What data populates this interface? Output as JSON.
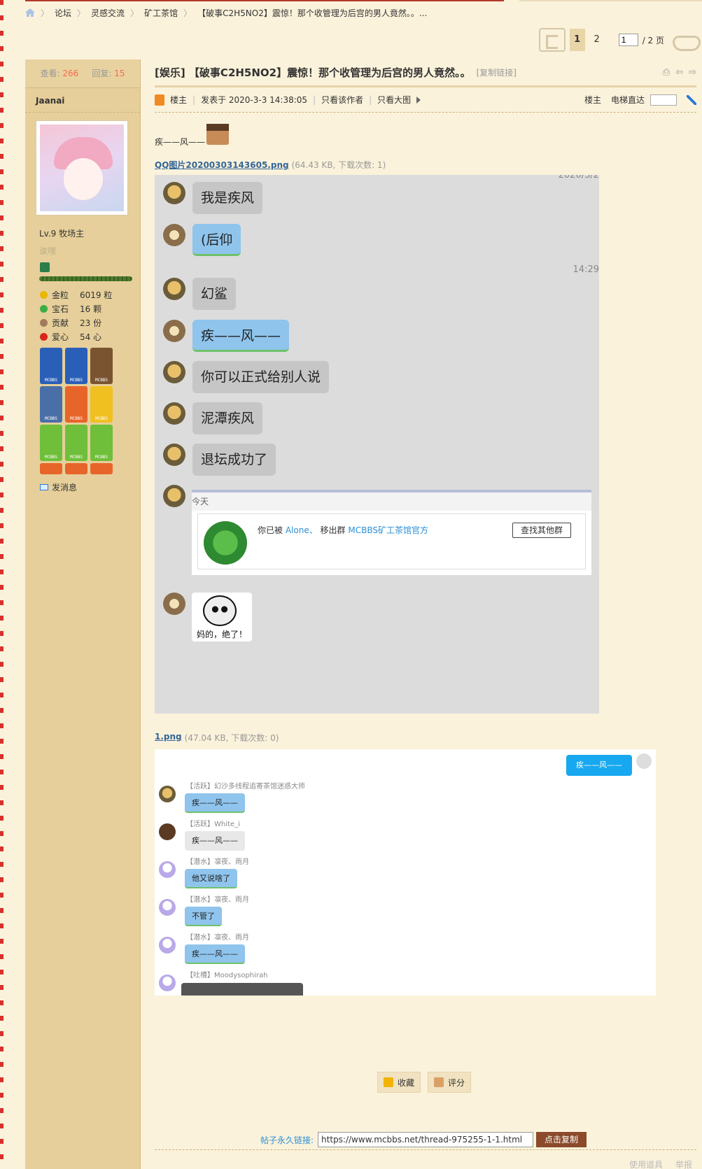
{
  "breadcrumb": [
    "论坛",
    "灵感交流",
    "矿工茶馆",
    "【破事C2H5NO2】震惊！那个收管理为后宫的男人竟然。。..."
  ],
  "pager": {
    "pages": [
      "1",
      "2"
    ],
    "current": "1",
    "input_value": "1",
    "total": "/ 2 页"
  },
  "sidebar": {
    "views_label": "查看:",
    "views": "266",
    "replies_label": "回复:",
    "replies": "15",
    "username": "Jaanai",
    "level": "Lv.9 牧场主",
    "usertitle": "诶嘿",
    "stats": [
      {
        "k": "金粒",
        "v": "6019 粒",
        "color": "#e9b600"
      },
      {
        "k": "宝石",
        "v": "16 颗",
        "color": "#3cae44"
      },
      {
        "k": "贡献",
        "v": "23 份",
        "color": "#a07a5a"
      },
      {
        "k": "爱心",
        "v": "54 心",
        "color": "#d8261b"
      }
    ],
    "medals": [
      {
        "label": "MCBBS",
        "color": "#2a5fb8"
      },
      {
        "label": "MCBBS",
        "color": "#2a5fb8"
      },
      {
        "label": "MCBBS",
        "color": "#7a5430"
      },
      {
        "label": "MCBBS",
        "color": "#4a6fa8"
      },
      {
        "label": "MCBBS",
        "color": "#e8652a"
      },
      {
        "label": "MCBBS",
        "color": "#f0c020"
      },
      {
        "label": "MCBBS",
        "color": "#6fbf3a"
      },
      {
        "label": "MCBBS",
        "color": "#6fbf3a"
      },
      {
        "label": "MCBBS",
        "color": "#6fbf3a"
      }
    ],
    "send_message": "发消息"
  },
  "post": {
    "title": "[娱乐] 【破事C2H5NO2】震惊！那个收管理为后宫的男人竟然。。",
    "copy_link": "[复制链接]",
    "louzhu": "楼主",
    "posted": "发表于 2020-3-3 14:38:05",
    "only_author": "只看该作者",
    "big_image": "只看大图",
    "floor": "楼主",
    "elevator": "电梯直达",
    "body_text": "疾——风——"
  },
  "attachment1": {
    "name": "QQ图片20200303143605.png",
    "info": "(64.43 KB, 下载次数: 1)"
  },
  "chat1": {
    "date_stamp": "2020/3/2",
    "time_stamp": "14:29",
    "messages": [
      "我是疾风",
      "(后仰",
      "幻鲨",
      "疾——风——",
      "你可以正式给别人说",
      "泥潭疾风",
      "退坛成功了"
    ],
    "card_day": "今天",
    "card_text_prefix": "你已被",
    "card_user": "Alone、",
    "card_text_mid": "移出群",
    "card_group": "MCBBS矿工茶馆官方",
    "card_button": "查找其他群",
    "sticker_caption": "妈的，绝了！"
  },
  "attachment2": {
    "name": "1.png",
    "info": "(47.04 KB, 下载次数: 0)"
  },
  "chat2": {
    "self_msg": "疾——风——",
    "rows": [
      {
        "name": "【活跃】幻沙多线程追寄茶馆迷惑大师",
        "msg": "疾——风——"
      },
      {
        "name": "【活跃】White_i",
        "msg": "疾——风——"
      },
      {
        "name": "【潜水】凛夜、雨月",
        "msg": "他又说啥了"
      },
      {
        "name": "【潜水】凛夜、雨月",
        "msg": "不管了"
      },
      {
        "name": "【潜水】凛夜、雨月",
        "msg": "疾——风——"
      },
      {
        "name": "【吐槽】Moodysophirah",
        "msg": ""
      }
    ]
  },
  "actions": {
    "favorite": "收藏",
    "rate": "评分"
  },
  "permalink": {
    "label": "帖子永久链接:",
    "url": "https://www.mcbbs.net/thread-975255-1-1.html",
    "button": "点击复制"
  },
  "footer": {
    "tools": "使用道具",
    "report": "举报"
  }
}
